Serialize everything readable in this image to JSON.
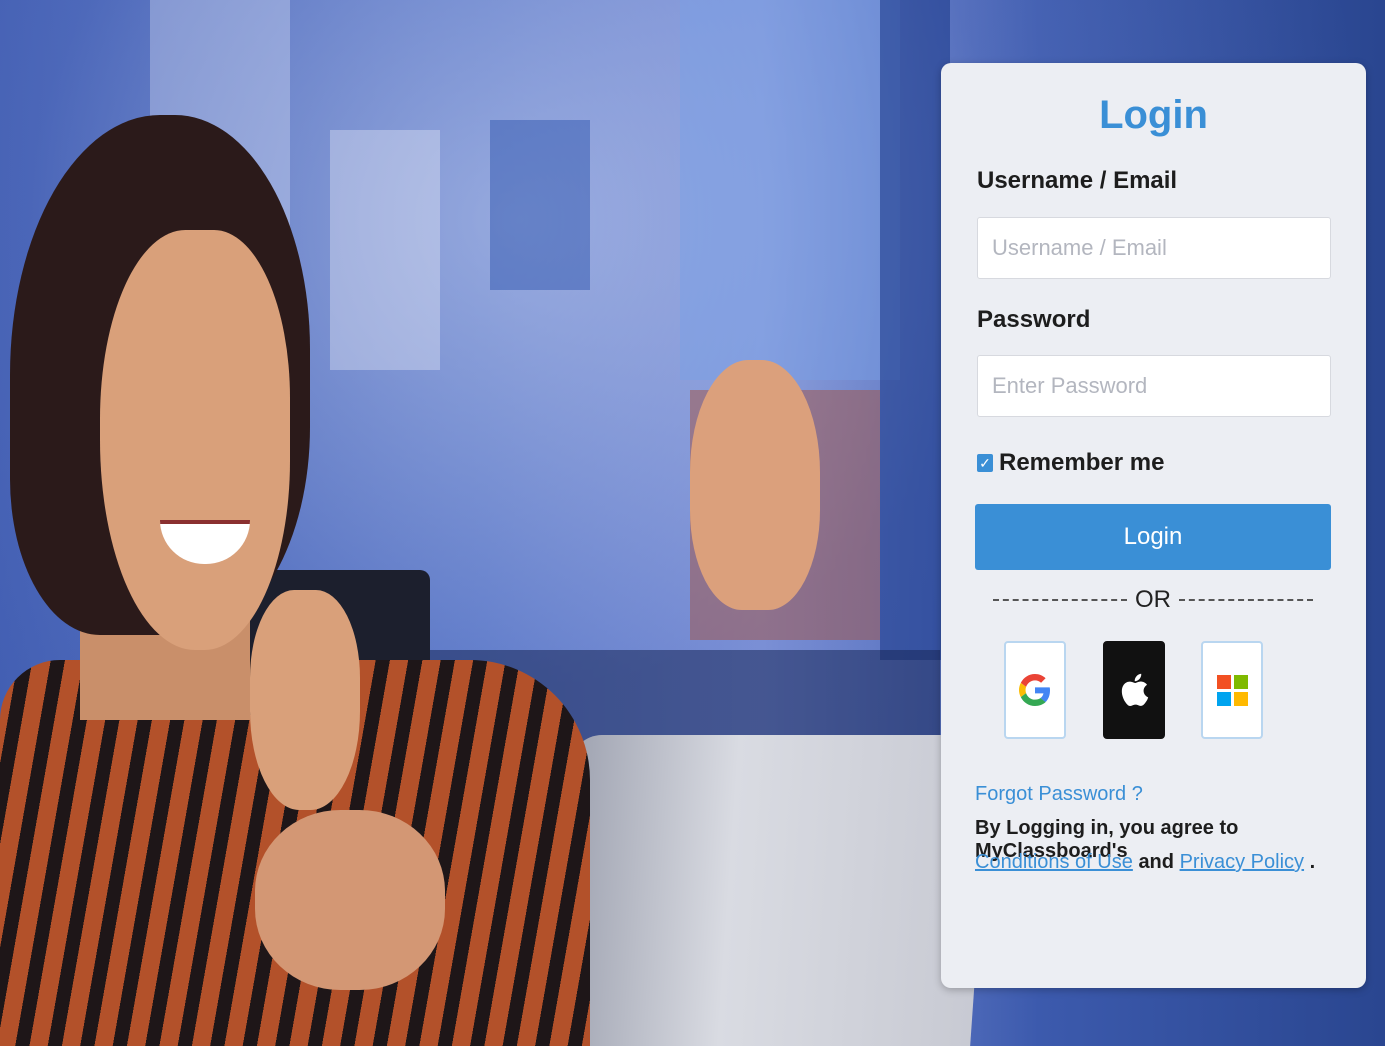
{
  "card": {
    "title": "Login",
    "username_label": "Username / Email",
    "username_placeholder": "Username / Email",
    "password_label": "Password",
    "password_placeholder": "Enter Password",
    "remember_label": "Remember me",
    "remember_checked": true,
    "login_button": "Login",
    "or_text": "OR",
    "social": [
      {
        "name": "google-icon"
      },
      {
        "name": "apple-icon"
      },
      {
        "name": "microsoft-icon"
      }
    ],
    "forgot_password": "Forgot Password ?",
    "agree_text": "By Logging in, you agree to MyClassboard's",
    "conditions_link": "Conditions of Use",
    "and_text": "and",
    "privacy_link": "Privacy Policy",
    "period": "."
  },
  "colors": {
    "accent": "#3a8fd6",
    "card_bg": "#eceef3"
  }
}
